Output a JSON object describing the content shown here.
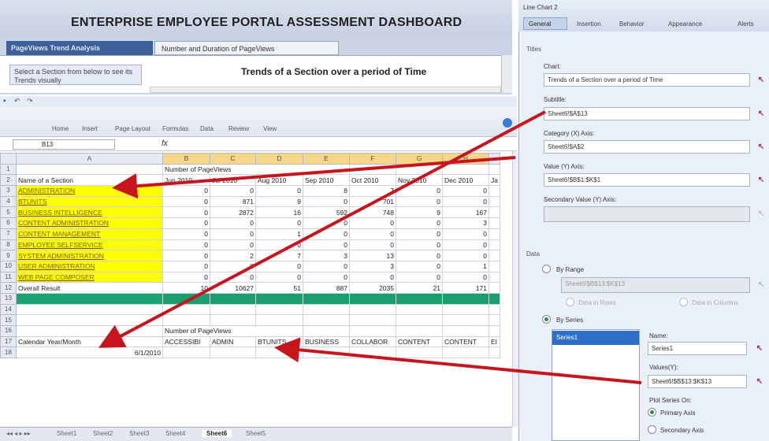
{
  "dashboard": {
    "title": "ENTERPRISE EMPLOYEE PORTAL ASSESSMENT DASHBOARD",
    "tabs": [
      "PageViews Trend Analysis",
      "Number and Duration of PageViews"
    ],
    "select_text": "Select a Section from below to see its Trends visually",
    "chart_title": "Trends of a Section over a period of Time"
  },
  "excel": {
    "ribbon_tabs": [
      "Home",
      "Insert",
      "Page Layout",
      "Formulas",
      "Data",
      "Review",
      "View"
    ],
    "name_box": "B13",
    "fx": "fx",
    "col_headers": [
      "A",
      "B",
      "C",
      "D",
      "E",
      "F",
      "G",
      "H"
    ],
    "row1_label": "Number of PageViews",
    "row2_header": [
      "Name of a Section",
      "Jun 2010",
      "Jul 2010",
      "Aug 2010",
      "Sep 2010",
      "Oct 2010",
      "Nov 2010",
      "Dec 2010",
      "Ja"
    ],
    "rows": [
      {
        "n": "3",
        "name": "ADMINISTRATION",
        "v": [
          "0",
          "0",
          "0",
          "8",
          "7",
          "0",
          "0"
        ]
      },
      {
        "n": "4",
        "name": "BTUNITS",
        "v": [
          "0",
          "871",
          "9",
          "0",
          "701",
          "0",
          "0"
        ]
      },
      {
        "n": "5",
        "name": "BUSINESS INTELLIGENCE",
        "v": [
          "0",
          "2872",
          "16",
          "592",
          "748",
          "9",
          "167"
        ]
      },
      {
        "n": "6",
        "name": "CONTENT ADMINISTRATION",
        "v": [
          "0",
          "0",
          "0",
          "0",
          "0",
          "0",
          "3"
        ]
      },
      {
        "n": "7",
        "name": "CONTENT MANAGEMENT",
        "v": [
          "0",
          "0",
          "1",
          "0",
          "0",
          "0",
          "0"
        ]
      },
      {
        "n": "8",
        "name": "EMPLOYEE SELFSERVICE",
        "v": [
          "0",
          "0",
          "0",
          "0",
          "0",
          "0",
          "0"
        ]
      },
      {
        "n": "9",
        "name": "SYSTEM ADMINISTRATION",
        "v": [
          "0",
          "2",
          "7",
          "3",
          "13",
          "0",
          "0"
        ]
      },
      {
        "n": "10",
        "name": "USER ADMINISTRATION",
        "v": [
          "0",
          "0",
          "0",
          "0",
          "3",
          "0",
          "1"
        ]
      },
      {
        "n": "11",
        "name": "WEB PAGE COMPOSER",
        "v": [
          "0",
          "0",
          "0",
          "0",
          "0",
          "0",
          "0"
        ]
      }
    ],
    "overall": {
      "n": "12",
      "name": "Overall Result",
      "v": [
        "10",
        "10627",
        "51",
        "887",
        "2035",
        "21",
        "171"
      ]
    },
    "row16_label": "Number of PageViews",
    "row17": [
      "Calendar Year/Month",
      "ACCESSIBI",
      "ADMIN",
      "BTUNITS",
      "BUSINESS",
      "COLLABOR",
      "CONTENT",
      "CONTENT",
      "EI"
    ],
    "row18_date": "6/1/2010",
    "sheet_tabs": [
      "Sheet1",
      "Sheet2",
      "Sheet3",
      "Sheet4",
      "Sheet6",
      "Sheet5"
    ]
  },
  "props": {
    "panel_title": "Line Chart 2",
    "tabs": [
      "General",
      "Insertion",
      "Behavior",
      "Appearance",
      "Alerts"
    ],
    "titles_header": "Titles",
    "chart_label": "Chart:",
    "chart_value": "Trends of a Section over a period of Time",
    "subtitle_label": "Subtitle:",
    "subtitle_value": "Sheet6!$A$13",
    "category_label": "Category (X) Axis:",
    "category_value": "Sheet6!$A$2",
    "value_label": "Value (Y) Axis:",
    "value_value": "Sheet6!$B$1:$K$1",
    "secondary_label": "Secondary Value (Y) Axis:",
    "data_header": "Data",
    "by_range": "By Range",
    "range_value": "Sheet6!$B$13:$K$13",
    "data_rows": "Data in Rows",
    "data_cols": "Data in Columns",
    "by_series": "By Series",
    "series_item": "Series1",
    "name_label": "Name:",
    "name_value": "Series1",
    "values_label": "Values(Y):",
    "values_value": "Sheet6!$B$13:$K$13",
    "plot_on": "Plot Series On:",
    "primary": "Primary Axis",
    "secondary": "Secondary Axis"
  },
  "colors": {
    "highlight": "#ffff00",
    "selection": "#1ca373",
    "arrow": "#c8141c"
  }
}
